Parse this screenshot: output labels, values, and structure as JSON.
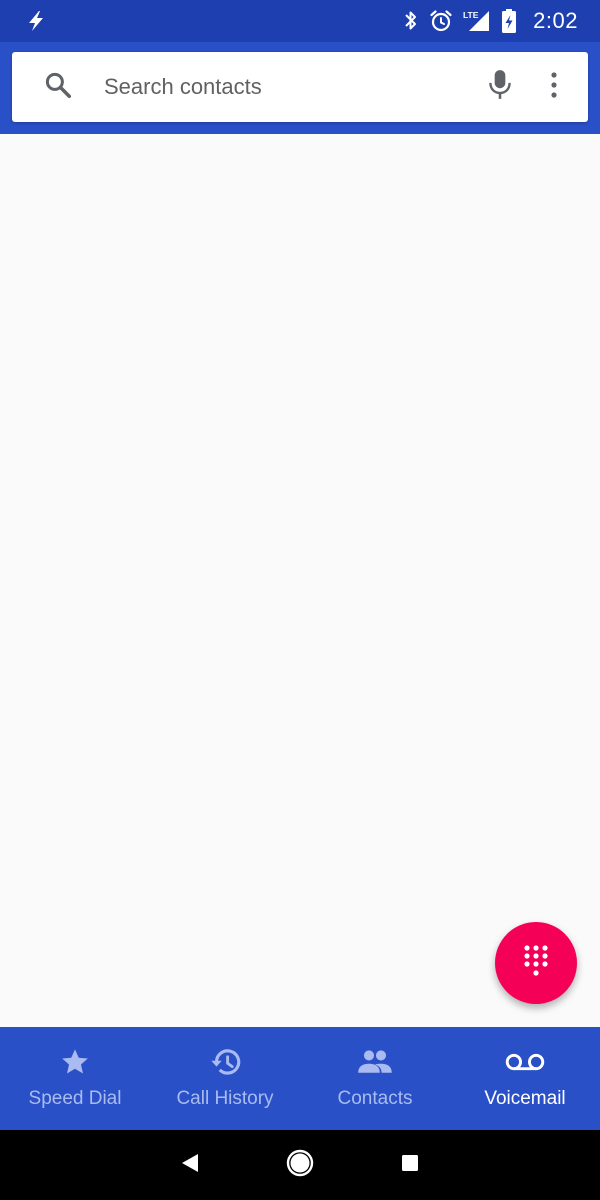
{
  "status_bar": {
    "time": "2:02",
    "network_label": "LTE",
    "icons": [
      "bolt-icon",
      "bluetooth-icon",
      "alarm-icon",
      "lte-signal-icon",
      "battery-charging-icon"
    ]
  },
  "search": {
    "placeholder": "Search contacts",
    "value": ""
  },
  "fab": {
    "icon": "dialpad-icon"
  },
  "bottom_nav": {
    "items": [
      {
        "label": "Speed Dial",
        "icon": "star-icon",
        "active": false
      },
      {
        "label": "Call History",
        "icon": "history-icon",
        "active": false
      },
      {
        "label": "Contacts",
        "icon": "people-icon",
        "active": false
      },
      {
        "label": "Voicemail",
        "icon": "voicemail-icon",
        "active": true
      }
    ]
  },
  "system_nav": {
    "icons": [
      "back-icon",
      "home-icon",
      "recents-icon"
    ]
  },
  "colors": {
    "status_bar": "#1e3fb0",
    "primary": "#2a50c8",
    "fab": "#f50057",
    "background": "#fafafa",
    "nav_inactive": "#a9bbf0",
    "nav_active": "#ffffff"
  }
}
